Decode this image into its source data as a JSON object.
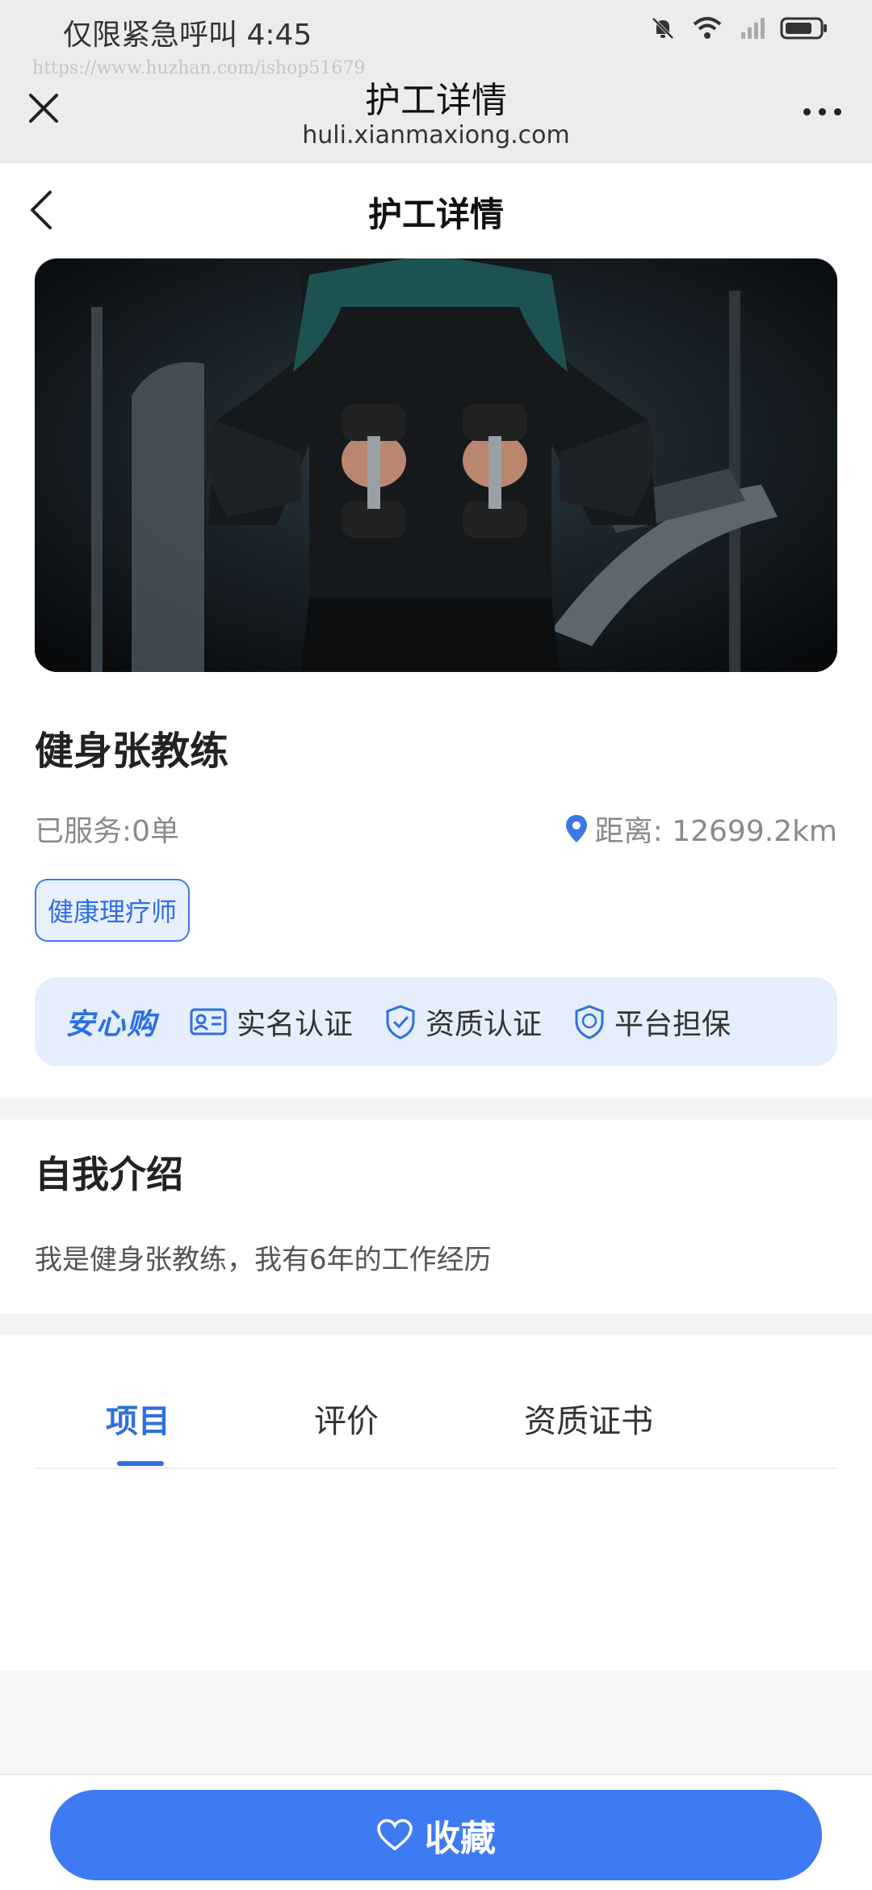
{
  "status_bar": {
    "left_text": "仅限紧急呼叫 4:45"
  },
  "browser": {
    "watermark": "https://www.huzhan.com/ishop51679",
    "title": "护工详情",
    "url": "huli.xianmaxiong.com"
  },
  "nav": {
    "title": "护工详情"
  },
  "profile": {
    "name": "健身张教练",
    "served": "已服务:0单",
    "distance": "距离:  12699.2km",
    "tag": "健康理疗师"
  },
  "assurance": {
    "brand": "安心购",
    "items": [
      "实名认证",
      "资质认证",
      "平台担保"
    ]
  },
  "intro": {
    "title": "自我介绍",
    "text": "我是健身张教练，我有6年的工作经历"
  },
  "tabs": [
    "项目",
    "评价",
    "资质证书"
  ],
  "bottom": {
    "favorite_label": "收藏"
  },
  "colors": {
    "accent": "#2f6fdf",
    "button": "#3e7bf2"
  }
}
